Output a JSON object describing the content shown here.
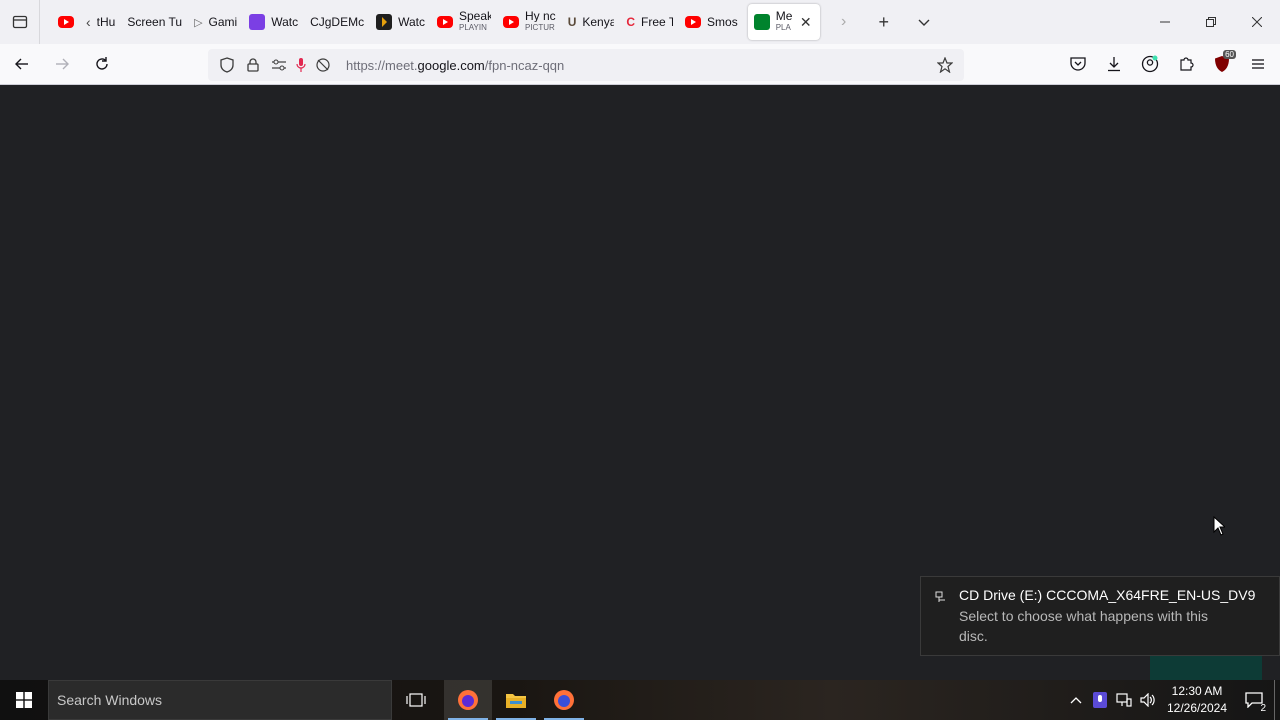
{
  "browser": {
    "tabs": [
      {
        "label": "",
        "sub": "",
        "icon": "youtube-icon"
      },
      {
        "label": "tHu",
        "sub": "",
        "icon": "back-chevron-icon"
      },
      {
        "label": "Screen Tu",
        "sub": "",
        "icon": ""
      },
      {
        "label": "Gami",
        "sub": "",
        "icon": "play-outline-icon"
      },
      {
        "label": "Watc",
        "sub": "",
        "icon": "twitch-icon"
      },
      {
        "label": "CJgDEMc",
        "sub": "",
        "icon": ""
      },
      {
        "label": "Watc",
        "sub": "",
        "icon": "plex-icon"
      },
      {
        "label": "Speak",
        "sub": "PLAYIN",
        "icon": "youtube-icon"
      },
      {
        "label": "Hy nc",
        "sub": "PICTUR",
        "icon": "youtube-icon"
      },
      {
        "label": "Kenya",
        "sub": "",
        "icon": "u-logo-icon"
      },
      {
        "label": "Free T",
        "sub": "",
        "icon": "cc-logo-icon"
      },
      {
        "label": "Smos",
        "sub": "",
        "icon": "youtube-icon"
      },
      {
        "label": "Me",
        "sub": "PLA",
        "icon": "meet-icon"
      }
    ],
    "url": {
      "prefix": "https://meet.",
      "domain": "google.com",
      "path": "/fpn-ncaz-qqn"
    },
    "extension_badge": "60"
  },
  "notification": {
    "title": "CD Drive (E:) CCCOMA_X64FRE_EN-US_DV9",
    "body": "Select to choose what happens with this disc."
  },
  "taskbar": {
    "search_placeholder": "Search Windows",
    "time": "12:30 AM",
    "date": "12/26/2024",
    "notification_count": "2"
  }
}
